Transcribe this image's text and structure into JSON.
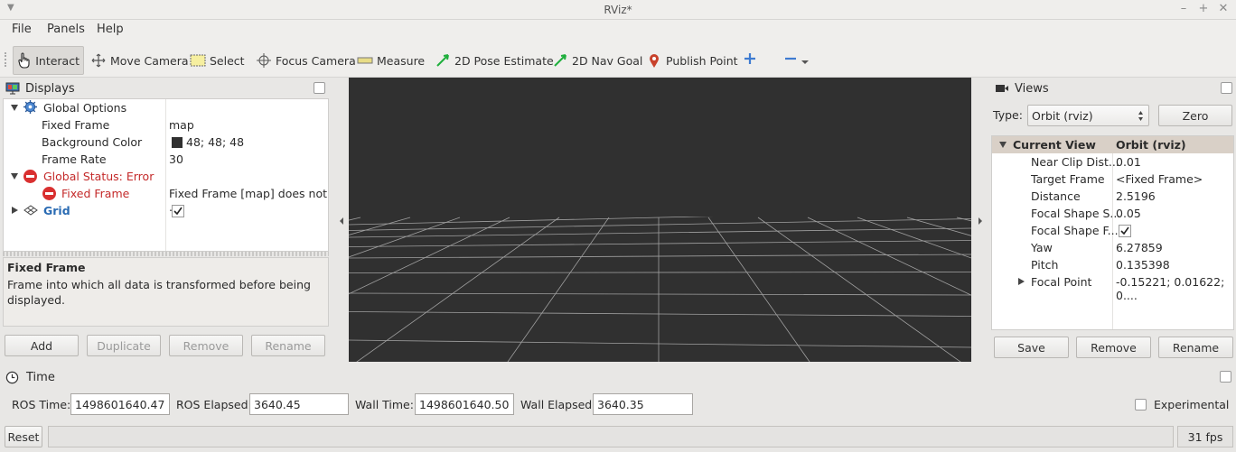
{
  "window": {
    "title": "RViz*"
  },
  "menu": [
    "File",
    "Panels",
    "Help"
  ],
  "toolbar": {
    "interact": "Interact",
    "move_camera": "Move Camera",
    "select": "Select",
    "focus_camera": "Focus Camera",
    "measure": "Measure",
    "pose_estimate": "2D Pose Estimate",
    "nav_goal": "2D Nav Goal",
    "publish_point": "Publish Point"
  },
  "displays": {
    "title": "Displays",
    "global_options": "Global Options",
    "fixed_frame_label": "Fixed Frame",
    "fixed_frame_value": "map",
    "bg_color_label": "Background Color",
    "bg_color_value": "48; 48; 48",
    "bg_color_hex": "#303030",
    "frame_rate_label": "Frame Rate",
    "frame_rate_value": "30",
    "global_status": "Global Status: Error",
    "status_fixed_frame_label": "Fixed Frame",
    "status_fixed_frame_value": "Fixed Frame [map] does not ...",
    "grid_label": "Grid",
    "help_title": "Fixed Frame",
    "help_text": "Frame into which all data is transformed before being displayed.",
    "buttons": {
      "add": "Add",
      "duplicate": "Duplicate",
      "remove": "Remove",
      "rename": "Rename"
    }
  },
  "views": {
    "title": "Views",
    "type_label": "Type:",
    "type_value": "Orbit (rviz)",
    "zero": "Zero",
    "header_key": "Current View",
    "header_value": "Orbit (rviz)",
    "rows": [
      {
        "key": "Near Clip Dist...",
        "value": "0.01"
      },
      {
        "key": "Target Frame",
        "value": "<Fixed Frame>"
      },
      {
        "key": "Distance",
        "value": "2.5196"
      },
      {
        "key": "Focal Shape S...",
        "value": "0.05"
      },
      {
        "key": "Focal Shape F...",
        "value": ""
      },
      {
        "key": "Yaw",
        "value": "6.27859"
      },
      {
        "key": "Pitch",
        "value": "0.135398"
      },
      {
        "key": "Focal Point",
        "value": "-0.15221; 0.01622; 0...."
      }
    ],
    "buttons": {
      "save": "Save",
      "remove": "Remove",
      "rename": "Rename"
    }
  },
  "time": {
    "title": "Time",
    "ros_time_label": "ROS Time:",
    "ros_time": "1498601640.47",
    "ros_elapsed_label": "ROS Elapsed:",
    "ros_elapsed": "3640.45",
    "wall_time_label": "Wall Time:",
    "wall_time": "1498601640.50",
    "wall_elapsed_label": "Wall Elapsed:",
    "wall_elapsed": "3640.35",
    "experimental": "Experimental"
  },
  "status": {
    "reset": "Reset",
    "fps": "31 fps"
  }
}
